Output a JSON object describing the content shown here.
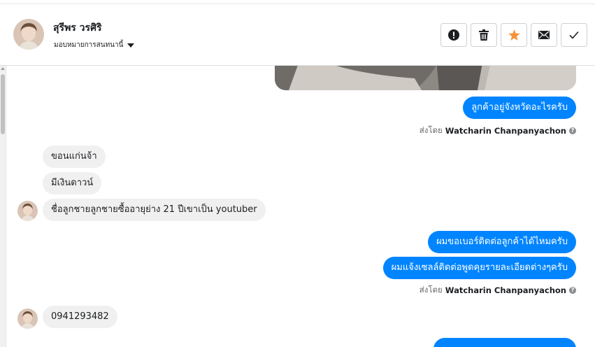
{
  "contact": {
    "name": "สุรีพร วรศิริ",
    "assign_label": "มอบหมายการสนทนานี้"
  },
  "toolbar": {
    "buttons": [
      {
        "icon": "alert-icon",
        "label": "Mark as spam"
      },
      {
        "icon": "trash-icon",
        "label": "Delete"
      },
      {
        "icon": "star-icon",
        "label": "Star"
      },
      {
        "icon": "envelope-icon",
        "label": "Mark as unread"
      },
      {
        "icon": "check-icon",
        "label": "Mark as done"
      }
    ],
    "star_color": "#f7923a"
  },
  "messages": [
    {
      "dir": "out",
      "text": "ลูกค้าอยู่จังหวัดอะไรครับ"
    },
    {
      "type": "sent_by",
      "prefix": "ส่งโดย",
      "agent": "Watcharin Chanpanyachon"
    },
    {
      "dir": "in",
      "text": "ขอนแก่นจ้า"
    },
    {
      "dir": "in",
      "text": "มีเงินดาวน์"
    },
    {
      "dir": "in",
      "text": "ชื่อลูกชายลูกชายซื้ออายุย่าง 21 ปีเขาเป็น youtuber"
    },
    {
      "dir": "out",
      "text": "ผมขอเบอร์ติดต่อลูกค้าได้ไหมครับ"
    },
    {
      "dir": "out",
      "text": "ผมแจ้งเซลล์ติดต่อพูดคุยรายละเอียดต่างๆครับ"
    },
    {
      "type": "sent_by",
      "prefix": "ส่งโดย",
      "agent": "Watcharin Chanpanyachon"
    },
    {
      "dir": "in",
      "text": "0941293482"
    }
  ],
  "colors": {
    "outgoing_bubble": "#0084ff",
    "incoming_bubble": "#f0f0f0"
  }
}
